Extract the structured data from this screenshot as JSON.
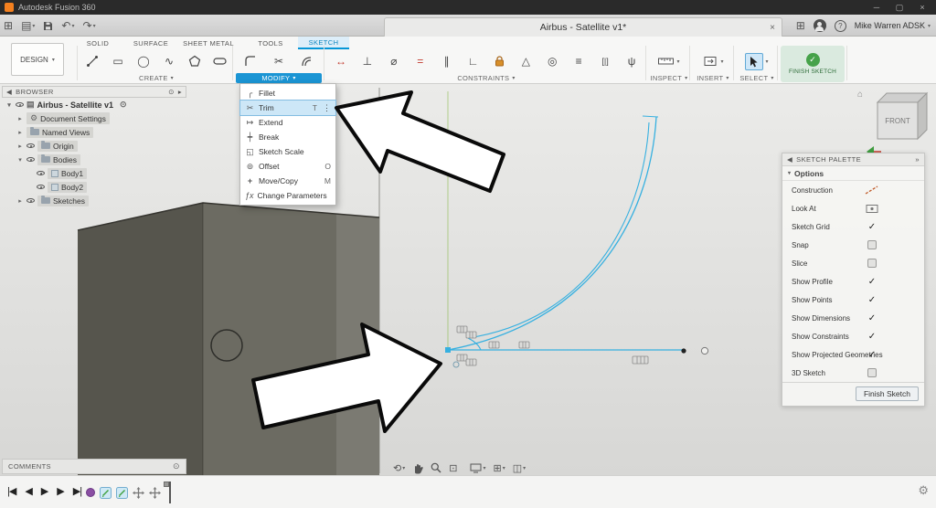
{
  "titlebar": {
    "app_title": "Autodesk Fusion 360"
  },
  "window_controls": {
    "minimize": "─",
    "maximize": "▢",
    "close": "×"
  },
  "appbar": {
    "doc_tab": {
      "title": "Airbus - Satellite v1*",
      "close": "×"
    },
    "user": {
      "name": "Mike Warren ADSK"
    }
  },
  "ribbon": {
    "workspace_label": "DESIGN",
    "tabs": [
      "SOLID",
      "SURFACE",
      "SHEET METAL",
      "TOOLS",
      "SKETCH"
    ],
    "active_tab": "SKETCH",
    "group_labels": {
      "create": "CREATE",
      "modify": "MODIFY",
      "constraints": "CONSTRAINTS",
      "inspect": "INSPECT",
      "insert": "INSERT",
      "select": "SELECT"
    },
    "finish_label": "FINISH SKETCH"
  },
  "modify_menu": {
    "items": [
      {
        "label": "Fillet",
        "shortcut": ""
      },
      {
        "label": "Trim",
        "shortcut": "T",
        "highlighted": true
      },
      {
        "label": "Extend",
        "shortcut": ""
      },
      {
        "label": "Break",
        "shortcut": ""
      },
      {
        "label": "Sketch Scale",
        "shortcut": ""
      },
      {
        "label": "Offset",
        "shortcut": "O"
      },
      {
        "label": "Move/Copy",
        "shortcut": "M"
      },
      {
        "label": "Change Parameters",
        "shortcut": ""
      }
    ]
  },
  "browser": {
    "title": "BROWSER",
    "root_label": "Airbus - Satellite v1",
    "rows": [
      {
        "label": "Document Settings"
      },
      {
        "label": "Named Views"
      },
      {
        "label": "Origin"
      },
      {
        "label": "Bodies"
      },
      {
        "label": "Body1"
      },
      {
        "label": "Body2"
      },
      {
        "label": "Sketches"
      }
    ]
  },
  "viewcube": {
    "front_label": "FRONT"
  },
  "sketch_palette": {
    "title": "SKETCH PALETTE",
    "section_label": "Options",
    "options": [
      {
        "label": "Construction",
        "control": "icon"
      },
      {
        "label": "Look At",
        "control": "icon"
      },
      {
        "label": "Sketch Grid",
        "control": "checked"
      },
      {
        "label": "Snap",
        "control": "unchecked"
      },
      {
        "label": "Slice",
        "control": "unchecked"
      },
      {
        "label": "Show Profile",
        "control": "checked"
      },
      {
        "label": "Show Points",
        "control": "checked"
      },
      {
        "label": "Show Dimensions",
        "control": "checked"
      },
      {
        "label": "Show Constraints",
        "control": "checked"
      },
      {
        "label": "Show Projected Geometries",
        "control": "checked"
      },
      {
        "label": "3D Sketch",
        "control": "unchecked"
      }
    ],
    "finish_button": "Finish Sketch"
  },
  "comments": {
    "label": "COMMENTS"
  },
  "icons": {
    "caret_down": "▾",
    "chevron_left": "◀",
    "chevron_right": "▸",
    "panel_popout": "»",
    "ellipsis_v": "⋮",
    "target": "⊙",
    "apps_grid": "⊞",
    "document": "▤",
    "undo": "↶",
    "redo": "↷",
    "help": "?",
    "gear": "⚙",
    "home": "⌂",
    "scissors": "✂",
    "fillet": "╭",
    "extend": "↦",
    "break": "┿",
    "scale": "◱",
    "offset": "⊚",
    "move": "+",
    "fx": "ƒx",
    "check": "✓",
    "rectangle": "▭",
    "circle": "◯",
    "spline": "∿",
    "dimension": "↔",
    "coincident": "⊥",
    "tangent": "⌀",
    "equal": "=",
    "parallel": "∥",
    "perpendicular": "∟",
    "midpoint": "△",
    "concentric": "◎",
    "collinear": "≡",
    "symmetry": "[|]",
    "curvature": "ψ",
    "orbit": "⟲",
    "fit": "⊡",
    "grid": "⊞",
    "viewports": "◫",
    "skip_start": "|◀",
    "step_back": "◀",
    "play": "▶",
    "step_forward": "▶",
    "skip_end": "▶|"
  },
  "colors": {
    "accent_blue": "#0696d7",
    "sketch_blue": "#36b0e0",
    "finish_green": "#46a24a",
    "menu_highlight": "#cde7f7",
    "lock_orange": "#d88f2a"
  }
}
